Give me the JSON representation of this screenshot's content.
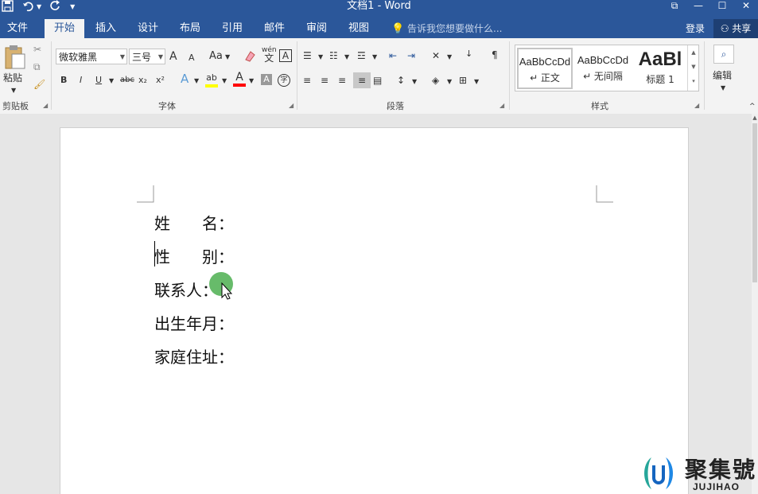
{
  "titlebar": {
    "title": "文档1 - Word",
    "qat": [
      "save-icon",
      "undo-icon",
      "redo-icon",
      "customize-icon"
    ],
    "window_buttons": [
      "ribbon-display-icon",
      "minimize-icon",
      "maximize-icon",
      "close-icon"
    ]
  },
  "tabs": [
    {
      "label": "文件"
    },
    {
      "label": "开始"
    },
    {
      "label": "插入"
    },
    {
      "label": "设计"
    },
    {
      "label": "布局"
    },
    {
      "label": "引用"
    },
    {
      "label": "邮件"
    },
    {
      "label": "审阅"
    },
    {
      "label": "视图"
    }
  ],
  "active_tab": "开始",
  "tellme": "告诉我您想要做什么...",
  "account": {
    "login": "登录",
    "share": "共享"
  },
  "ribbon": {
    "clipboard": {
      "paste": "粘贴",
      "label": "剪贴板"
    },
    "font": {
      "name": "微软雅黑",
      "size": "三号",
      "label": "字体",
      "bold": "B",
      "italic": "I",
      "underline": "U",
      "strike": "abc",
      "subscript": "x₂",
      "superscript": "x²",
      "grow": "A",
      "shrink": "A",
      "case": "Aa",
      "phonetic": "wén",
      "phonetic_char": "文",
      "border_char": "A",
      "shade_char": "A",
      "enclose_char": "字",
      "text_effect": "A",
      "highlight": "ab",
      "font_color": "A"
    },
    "paragraph": {
      "label": "段落"
    },
    "styles": {
      "label": "样式",
      "items": [
        {
          "sample": "AaBbCcDd",
          "name": "↵ 正文"
        },
        {
          "sample": "AaBbCcDd",
          "name": "↵ 无间隔"
        },
        {
          "sample": "AaBl",
          "name": "标题 1"
        }
      ]
    },
    "editing": {
      "label": "编辑"
    }
  },
  "document": {
    "lines": [
      "姓　　名：",
      "性　　别：",
      "联系人：",
      "出生年月：",
      "家庭住址："
    ]
  },
  "watermark": {
    "brand_cn": "聚集號",
    "brand_en": "JUJIHAO"
  },
  "colors": {
    "title_blue": "#2b579a",
    "highlight_yellow": "#ffff00",
    "font_red": "#ff0000",
    "cursor_green": "#4caf50"
  }
}
